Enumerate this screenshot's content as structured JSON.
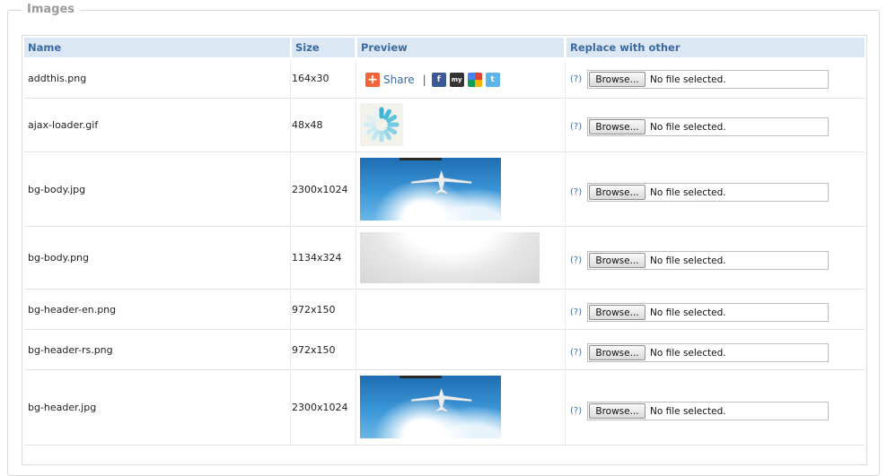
{
  "section": {
    "legend": "Images"
  },
  "table": {
    "headers": {
      "name": "Name",
      "size": "Size",
      "preview": "Preview",
      "replace": "Replace with other"
    },
    "help_link": "(?)",
    "browse_label": "Browse...",
    "file_status": "No file selected.",
    "share_label": "Share",
    "share_separator": "|",
    "rows": [
      {
        "name": "addthis.png",
        "size": "164x30"
      },
      {
        "name": "ajax-loader.gif",
        "size": "48x48"
      },
      {
        "name": "bg-body.jpg",
        "size": "2300x1024"
      },
      {
        "name": "bg-body.png",
        "size": "1134x324"
      },
      {
        "name": "bg-header-en.png",
        "size": "972x150"
      },
      {
        "name": "bg-header-rs.png",
        "size": "972x150"
      },
      {
        "name": "bg-header.jpg",
        "size": "2300x1024"
      }
    ]
  },
  "colors": {
    "header_bg": "#dce7f4",
    "header_text": "#3b6aa0",
    "link": "#3c6fb0",
    "share_orange": "#f4643a"
  },
  "icons": [
    "plus-icon",
    "facebook-icon",
    "myspace-icon",
    "google-icon",
    "twitter-icon",
    "loader-spinner",
    "airplane-image"
  ]
}
